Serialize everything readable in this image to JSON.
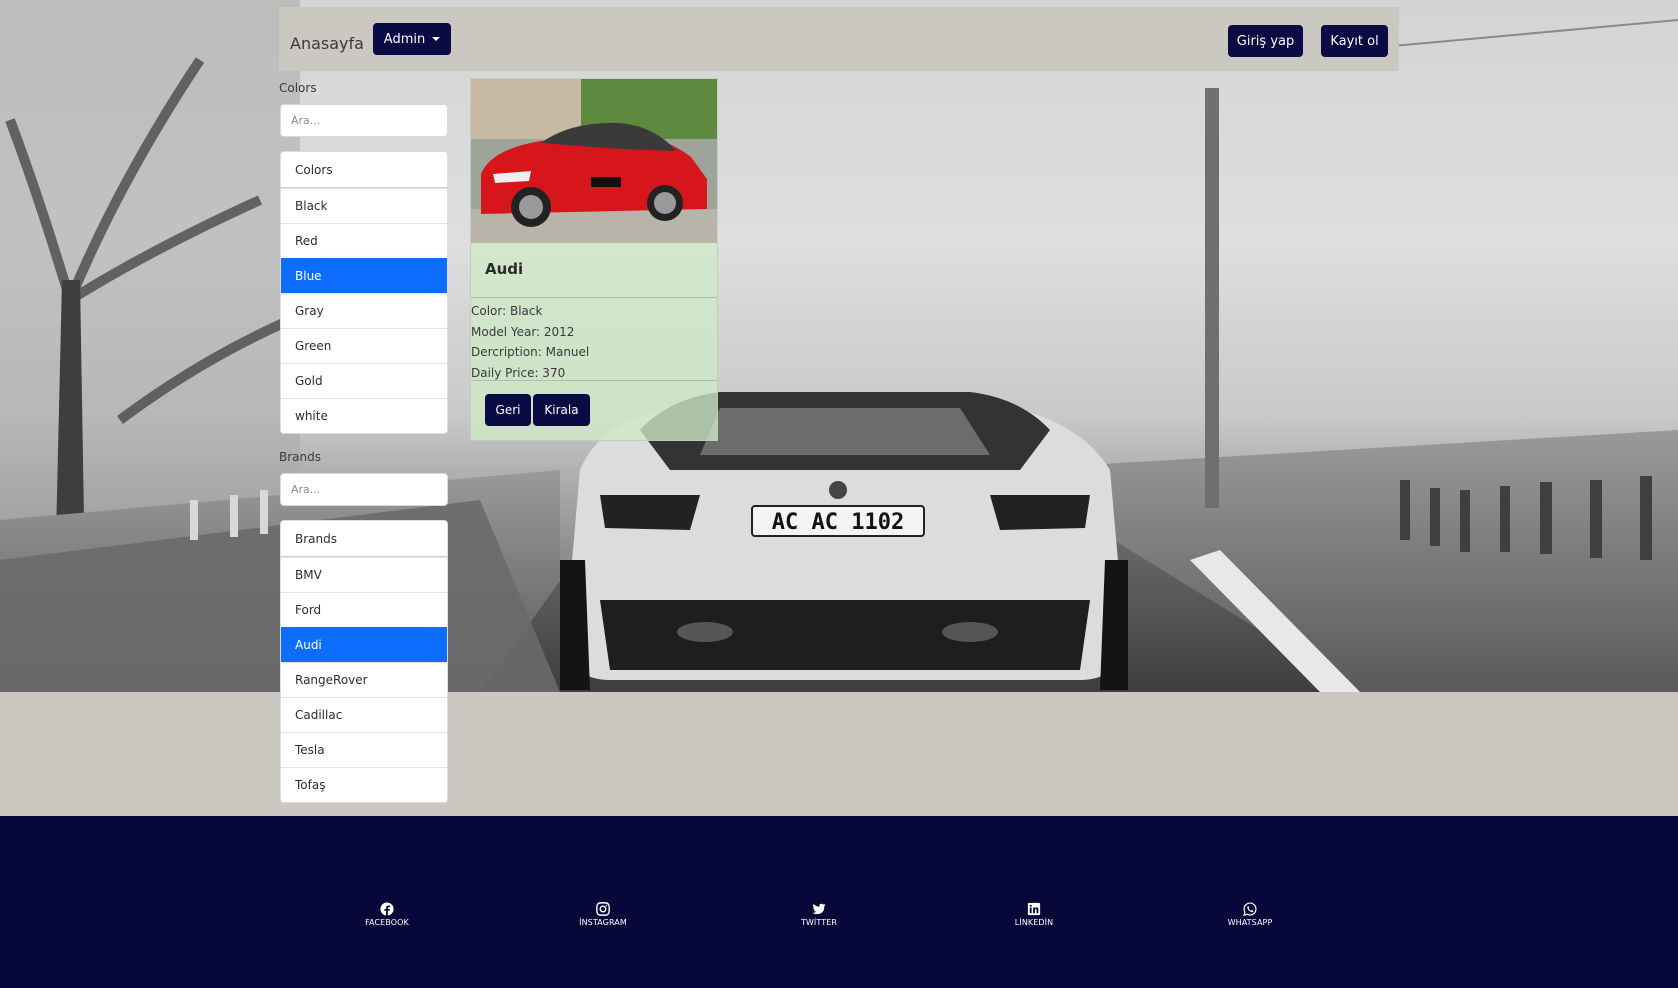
{
  "navbar": {
    "brand": "Anasayfa",
    "admin_label": "Admin",
    "login_label": "Giriş yap",
    "register_label": "Kayıt ol"
  },
  "colors_filter": {
    "title": "Colors",
    "search_placeholder": "Ara...",
    "items": [
      "Colors",
      "Black",
      "Red",
      "Blue",
      "Gray",
      "Green",
      "Gold",
      "white"
    ],
    "active": "Blue"
  },
  "brands_filter": {
    "title": "Brands",
    "search_placeholder": "Ara...",
    "items": [
      "Brands",
      "BMV",
      "Ford",
      "Audi",
      "RangeRover",
      "Cadillac",
      "Tesla",
      "Tofaş"
    ],
    "active": "Audi"
  },
  "car_card": {
    "image": "red-car-photo",
    "title": "Audi",
    "color": "Color: Black",
    "model_year": "Model Year: 2012",
    "description": "Dercription: Manuel",
    "daily_price": "Daily Price: 370",
    "back_label": "Geri",
    "rent_label": "Kirala"
  },
  "background": {
    "plate_text": "AC AC 1102"
  },
  "footer": {
    "links": [
      {
        "label": "FACEBOOK",
        "icon": "facebook-icon"
      },
      {
        "label": "İNSTAGRAM",
        "icon": "instagram-icon"
      },
      {
        "label": "TWİTTER",
        "icon": "twitter-icon"
      },
      {
        "label": "LİNKEDİN",
        "icon": "linkedin-icon"
      },
      {
        "label": "WHATSAPP",
        "icon": "whatsapp-icon"
      }
    ]
  },
  "colors": {
    "navy": "#0a0a45",
    "active_blue": "#0d6efd",
    "nav_bg": "#cac8c0",
    "card_bg": "#d0e9c8"
  }
}
